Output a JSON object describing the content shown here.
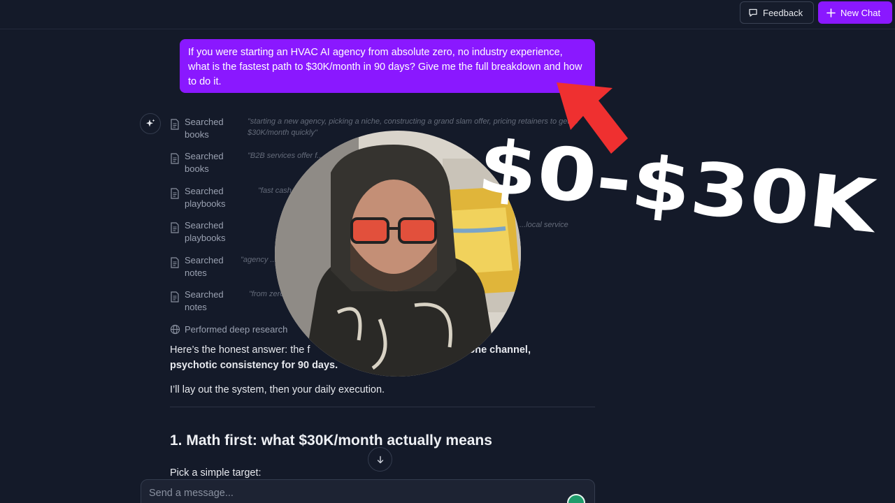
{
  "header": {
    "feedback_label": "Feedback",
    "new_chat_label": "New Chat"
  },
  "user_message": "If you were starting an HVAC AI agency from absolute zero, no industry experience, what is the fastest path to $30K/month in 90 days? Give me the full breakdown and how to do it.",
  "searches": [
    {
      "label": "Searched books",
      "query": "\"starting a new agency, picking a niche, constructing a grand slam offer, pricing retainers to get to $30K/month quickly\""
    },
    {
      "label": "Searched books",
      "query": "\"B2B services offer f... guarantees and pay-for-performance\""
    },
    {
      "label": "Searched playbooks",
      "query": "\"fast cash ... before th...\""
    },
    {
      "label": "Searched playbooks",
      "query": "...local service"
    },
    {
      "label": "Searched notes",
      "query": "\"agency ... services; constraints, best offer...\""
    },
    {
      "label": "Searched notes",
      "query": "\"from zero... ...y; client count, pricing, ac...\""
    }
  ],
  "deep_research_label": "Performed deep research",
  "answer": {
    "para1_start": "Here’s the honest answer: the f",
    "para1_bold_a": "atar, one channel,",
    "para1_bold_b": "psychotic consistency for 90 days.",
    "para2": "I’ll lay out the system, then your daily execution.",
    "heading": "1. Math first: what $30K/month actually means",
    "pick": "Pick a simple target:"
  },
  "composer": {
    "placeholder": "Send a message..."
  },
  "overlay": {
    "headline": "$0-$30K",
    "accent_color": "#ef3030",
    "text_color": "#ffffff"
  },
  "colors": {
    "background": "#141a29",
    "brand": "#8a18ff"
  }
}
